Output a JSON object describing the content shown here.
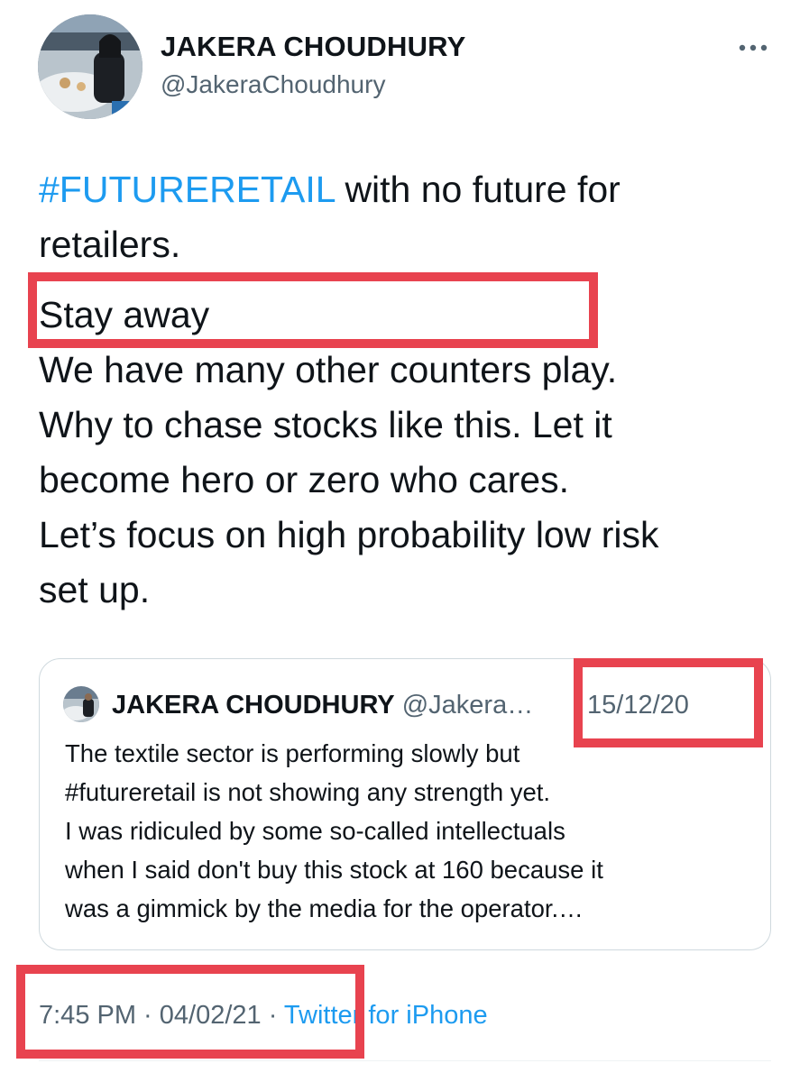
{
  "author": {
    "name": "JAKERA CHOUDHURY",
    "handle": "@JakeraChoudhury"
  },
  "tweet": {
    "hashtag": "#FUTURERETAIL",
    "line1_rest": " with no future for",
    "line2": "retailers.",
    "line3": "Stay away",
    "line4": "We have many other counters play.",
    "line5": "Why to chase stocks like this. Let it",
    "line6": "become hero or zero who cares.",
    "line7": "Let’s focus on high probability low risk",
    "line8": "set up."
  },
  "quote": {
    "name": "JAKERA CHOUDHURY",
    "handle": "@Jakera…",
    "date": "15/12/20",
    "lines": [
      "The textile sector is performing slowly but",
      "#futureretail is not showing any strength yet.",
      "I was ridiculed by some so-called intellectuals",
      "when I said don't buy this stock at 160 because it",
      "was a gimmick by the media for the operator.…"
    ]
  },
  "footer": {
    "time": "7:45 PM",
    "separator": " · ",
    "date": "04/02/21",
    "source": "Twitter for iPhone"
  },
  "colors": {
    "accent": "#1d9bf0",
    "secondary_text": "#536471",
    "highlight_box": "#e8434f"
  },
  "icons": {
    "more": "more-horizontal-icon"
  }
}
